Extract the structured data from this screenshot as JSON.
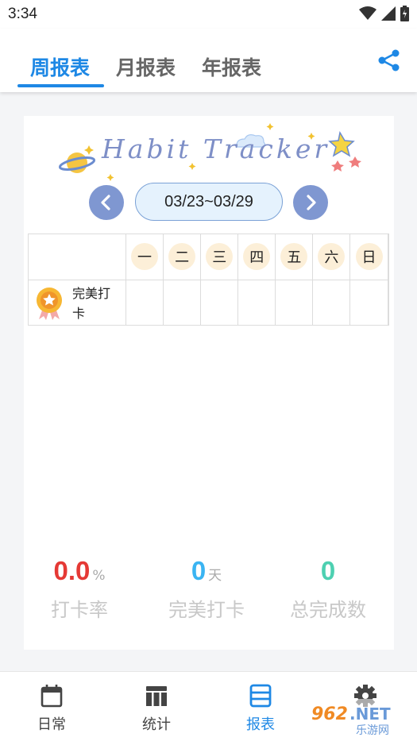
{
  "status_bar": {
    "time": "3:34",
    "icons": [
      "wifi-icon",
      "signal-icon",
      "battery-icon"
    ]
  },
  "tabs": [
    {
      "label": "周报表",
      "active": true
    },
    {
      "label": "月报表",
      "active": false
    },
    {
      "label": "年报表",
      "active": false
    }
  ],
  "header": {
    "share_icon": "share-icon"
  },
  "banner": {
    "title": "Habit Tracker"
  },
  "week": {
    "range": "03/23~03/29"
  },
  "table": {
    "days": [
      "一",
      "二",
      "三",
      "四",
      "五",
      "六",
      "日"
    ],
    "habits": [
      {
        "name": "完美打卡",
        "icon": "medal-icon",
        "checks": [
          false,
          false,
          false,
          false,
          false,
          false,
          false
        ]
      }
    ]
  },
  "stats": [
    {
      "value": "0.0",
      "unit": "%",
      "label": "打卡率",
      "color": "#e53935"
    },
    {
      "value": "0",
      "unit": "天",
      "label": "完美打卡",
      "color": "#3ab4f2"
    },
    {
      "value": "0",
      "unit": "",
      "label": "总完成数",
      "color": "#4dd0b1"
    }
  ],
  "bottom_nav": [
    {
      "label": "日常",
      "icon": "calendar-icon",
      "active": false
    },
    {
      "label": "统计",
      "icon": "stats-icon",
      "active": false
    },
    {
      "label": "报表",
      "icon": "report-icon",
      "active": true
    },
    {
      "label": "",
      "icon": "gear-icon",
      "active": false
    }
  ],
  "colors": {
    "accent": "#1e88e5",
    "nav_button": "#7f97d1"
  },
  "watermark": {
    "text": "962.NET 乐游网"
  }
}
